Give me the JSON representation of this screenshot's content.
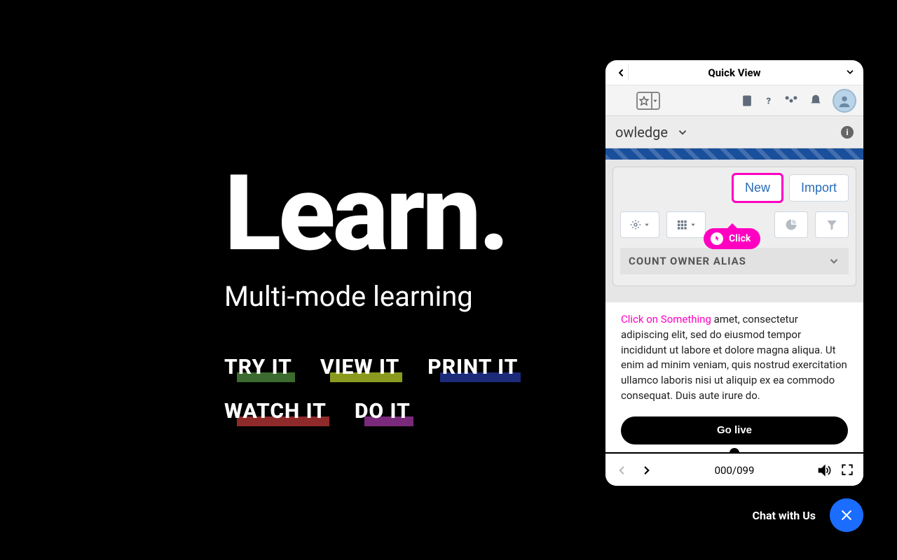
{
  "hero": {
    "headline": "Learn.",
    "subhead": "Multi-mode learning"
  },
  "modes": [
    {
      "label": "TRY IT",
      "color": "#3b6b2f"
    },
    {
      "label": "VIEW IT",
      "color": "#8a9a1f"
    },
    {
      "label": "PRINT IT",
      "color": "#1c2a7a"
    },
    {
      "label": "WATCH IT",
      "color": "#8f2a2a"
    },
    {
      "label": "DO IT",
      "color": "#7a2a7a"
    }
  ],
  "quickview": {
    "title": "Quick View",
    "knowledge_label": "owledge",
    "buttons": {
      "new": "New",
      "import": "Import"
    },
    "click_pill": "Click",
    "column_label": "COUNT OWNER ALIAS",
    "instruction_lead": "Click on Something",
    "instruction_body": " amet, consectetur adipiscing elit, sed do eiusmod tempor incididunt ut labore et dolore magna aliqua. Ut enim ad minim veniam, quis nostrud exercitation ullamco laboris nisi ut aliquip ex ea commodo consequat. Duis aute irure do.",
    "go_live": "Go live",
    "counter": "000/099"
  },
  "chat": {
    "label": "Chat with Us"
  }
}
